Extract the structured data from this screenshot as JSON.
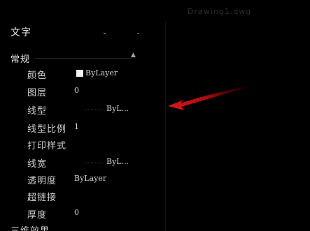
{
  "viewport": {
    "title": "Drawing1.dwg"
  },
  "panel": {
    "title": "文字",
    "section_general": "常规",
    "collapse_glyph": "▲",
    "properties": [
      {
        "label": "颜色",
        "value": "ByLayer",
        "swatch": "#f4f4f4"
      },
      {
        "label": "图层",
        "value": "0"
      },
      {
        "label": "线型",
        "value": "ByL..."
      },
      {
        "label": "线型比例",
        "value": "1"
      },
      {
        "label": "打印样式",
        "value": ""
      },
      {
        "label": "线宽",
        "value": "ByL..."
      },
      {
        "label": "透明度",
        "value": "ByLayer"
      },
      {
        "label": "超链接",
        "value": ""
      },
      {
        "label": "厚度",
        "value": "0"
      }
    ],
    "section_3d": "三维效果"
  },
  "colors": {
    "background": "#000000",
    "arrow": "#c81010"
  },
  "icons": {
    "arrow": "red-pointer-arrow-icon"
  }
}
